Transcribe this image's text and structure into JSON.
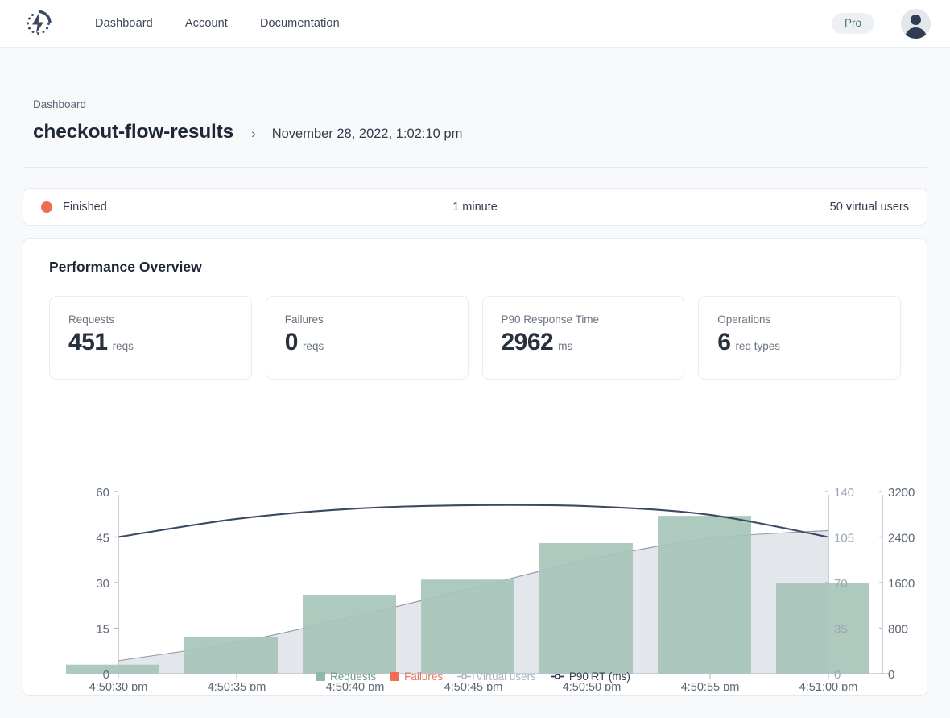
{
  "nav": {
    "logo_icon": "bolt-in-dotted-circle-icon",
    "items": [
      {
        "label": "Dashboard"
      },
      {
        "label": "Account"
      },
      {
        "label": "Documentation"
      }
    ],
    "plan_badge": "Pro",
    "avatar_icon": "user-avatar-icon"
  },
  "breadcrumb": {
    "parent": "Dashboard",
    "title": "checkout-flow-results",
    "separator": "›",
    "date": "November 28, 2022, 1:02:10 pm"
  },
  "status": {
    "state": "Finished",
    "state_color": "#ef6d55",
    "duration": "1 minute",
    "users": "50 virtual users"
  },
  "overview": {
    "title": "Performance Overview",
    "stats": [
      {
        "label": "Requests",
        "value": "451",
        "unit": "reqs"
      },
      {
        "label": "Failures",
        "value": "0",
        "unit": "reqs"
      },
      {
        "label": "P90 Response Time",
        "value": "2962",
        "unit": "ms"
      },
      {
        "label": "Operations",
        "value": "6",
        "unit": "req types"
      }
    ]
  },
  "chart_data": {
    "type": "bar",
    "title": "",
    "categories": [
      "4:50:30 pm",
      "4:50:35 pm",
      "4:50:40 pm",
      "4:50:45 pm",
      "4:50:50 pm",
      "4:50:55 pm",
      "4:51:00 pm"
    ],
    "series": [
      {
        "name": "Requests",
        "type": "bar",
        "axis": "left",
        "color": "#a7c5ba",
        "values": [
          3,
          12,
          26,
          31,
          43,
          52,
          30
        ]
      },
      {
        "name": "Failures",
        "type": "bar",
        "axis": "left",
        "color": "#ef6d55",
        "values": [
          0,
          0,
          0,
          0,
          0,
          0,
          0
        ]
      },
      {
        "name": "Virtual users",
        "type": "area",
        "axis": "right1",
        "color": "#9aa5b4",
        "fill": "#e3e6ea",
        "values": [
          10,
          24,
          44,
          66,
          88,
          104,
          110
        ]
      },
      {
        "name": "P90 RT (ms)",
        "type": "line",
        "axis": "right2",
        "color": "#3b4a61",
        "values": [
          2400,
          2720,
          2900,
          2960,
          2940,
          2790,
          2400
        ]
      }
    ],
    "axes": {
      "left": {
        "label": "",
        "ticks": [
          "0",
          "15",
          "30",
          "45",
          "60"
        ],
        "min": 0,
        "max": 60
      },
      "right1": {
        "label": "",
        "ticks": [
          "0",
          "35",
          "70",
          "105",
          "140"
        ],
        "min": 0,
        "max": 140,
        "color": "#9aa5b4"
      },
      "right2": {
        "label": "",
        "ticks": [
          "0",
          "800",
          "1600",
          "2400",
          "3200"
        ],
        "min": 0,
        "max": 3200
      }
    },
    "grid": false,
    "legend_position": "bottom",
    "legend": [
      {
        "label": "Requests",
        "marker": "square",
        "color": "#8fb8a7"
      },
      {
        "label": "Failures",
        "marker": "square",
        "color": "#ef6d55"
      },
      {
        "label": "Virtual users",
        "marker": "line-dot",
        "color": "#aab3bf"
      },
      {
        "label": "P90 RT (ms)",
        "marker": "line-dot",
        "color": "#2f3c52"
      }
    ]
  }
}
